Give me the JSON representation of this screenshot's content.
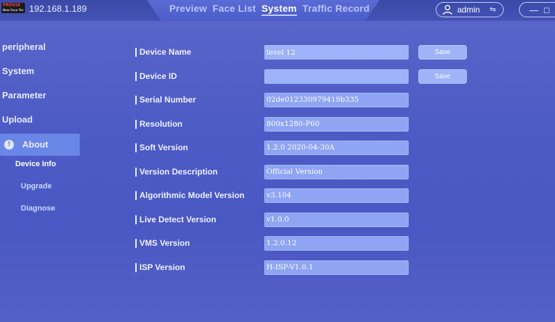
{
  "header": {
    "logo_text": "PROVIX",
    "logo_sub": "New Face Tec",
    "ip": "192.168.1.189",
    "tabs": [
      {
        "label": "Preview",
        "active": false
      },
      {
        "label": "Face List",
        "active": false
      },
      {
        "label": "System",
        "active": true
      },
      {
        "label": "Traffic Record",
        "active": false
      }
    ],
    "user": "admin",
    "switch_glyph": "⇋",
    "window_controls": [
      "—",
      "□",
      "✕"
    ]
  },
  "sidebar": {
    "items": [
      {
        "label": "peripheral"
      },
      {
        "label": "System"
      },
      {
        "label": "Parameter"
      },
      {
        "label": "Upload"
      },
      {
        "label": "About",
        "active": true
      }
    ],
    "sub_items": [
      {
        "label": "Device Info",
        "current": true
      },
      {
        "label": "Upgrade"
      },
      {
        "label": "Diagnose"
      }
    ]
  },
  "form": {
    "rows": [
      {
        "label": "Device Name",
        "value": "level 12",
        "editable": true,
        "button": "Save"
      },
      {
        "label": "Device ID",
        "value": "",
        "editable": true,
        "button": "Save"
      },
      {
        "label": "Serial Number",
        "value": "02de012330979419b335"
      },
      {
        "label": "Resolution",
        "value": "800x1280-P60"
      },
      {
        "label": "Soft Version",
        "value": "1.2.0 2020-04-30A"
      },
      {
        "label": "Version Description",
        "value": "Official Version"
      },
      {
        "label": "Algorithmic Model Version",
        "value": "v3.104"
      },
      {
        "label": "Live Detect Version",
        "value": "v1.0.0"
      },
      {
        "label": "VMS Version",
        "value": "1.2.0.12"
      },
      {
        "label": "ISP Version",
        "value": "H-ISP-V1.0.1"
      }
    ]
  },
  "colors": {
    "background": "#4d5bc6",
    "field": "#8fa4f2",
    "button": "#9fb3f6",
    "active_sidebar": "#6a86e6"
  }
}
